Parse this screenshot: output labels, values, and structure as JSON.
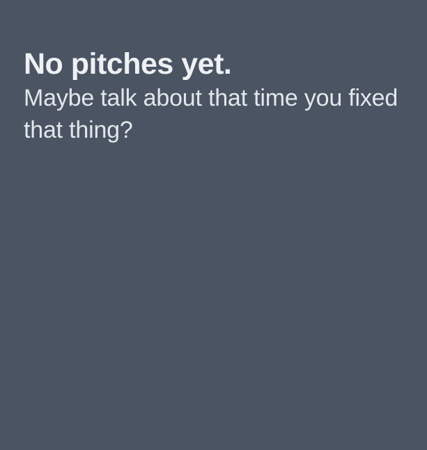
{
  "empty_state": {
    "title": "No pitches yet.",
    "message": "Maybe talk about that time you fixed that thing?"
  },
  "colors": {
    "background": "#4a5462",
    "title_text": "#eef0f3",
    "message_text": "#e3e7ec"
  }
}
